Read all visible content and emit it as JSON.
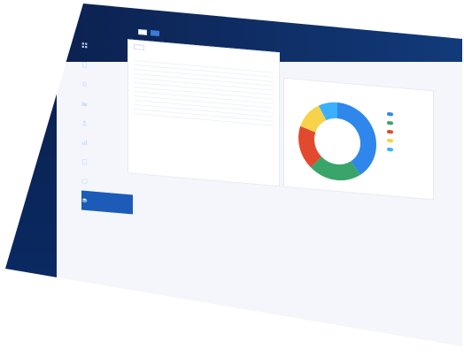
{
  "app": {
    "logo_text": "",
    "title": ""
  },
  "topbar": {
    "actions": [
      {
        "label": ""
      },
      {
        "label": ""
      },
      {
        "label": ""
      }
    ]
  },
  "tabs": [
    {
      "label": "",
      "active": false
    },
    {
      "label": "",
      "active": true
    }
  ],
  "sidebar": {
    "items": [
      {
        "label": "",
        "icon": "grid-icon"
      },
      {
        "label": "",
        "icon": "document-icon"
      },
      {
        "label": "",
        "icon": "settings-icon"
      },
      {
        "label": "",
        "icon": "folder-icon"
      },
      {
        "label": "",
        "icon": "user-icon"
      },
      {
        "label": "",
        "icon": "chart-icon"
      },
      {
        "label": "",
        "icon": "book-icon"
      },
      {
        "label": "",
        "icon": "cube-icon"
      },
      {
        "label": "",
        "icon": "layers-icon",
        "active": true
      },
      {
        "label": "",
        "icon": "list-icon",
        "sub": true
      },
      {
        "label": "",
        "icon": "list-icon",
        "sub": true
      },
      {
        "label": "",
        "icon": "list-icon",
        "sub": true
      },
      {
        "label": "",
        "icon": "list-icon",
        "sub": true
      },
      {
        "label": "",
        "icon": "shield-icon"
      }
    ]
  },
  "filters": {
    "select": ""
  },
  "stats": [
    {
      "label": ""
    },
    {
      "label": ""
    },
    {
      "label": ""
    }
  ],
  "table": {
    "columns": [
      "",
      "",
      "",
      "",
      "",
      "",
      "",
      ""
    ],
    "rows": [
      [
        "",
        "",
        "",
        "",
        "",
        "",
        "",
        ""
      ],
      [
        "",
        "",
        "",
        "",
        "",
        "",
        "",
        ""
      ],
      [
        "",
        "",
        "",
        "",
        "",
        "",
        "",
        ""
      ],
      [
        "",
        "",
        "",
        "",
        "",
        "",
        "",
        ""
      ],
      [
        "",
        "",
        "",
        "",
        "",
        "",
        "",
        ""
      ],
      [
        "",
        "",
        "",
        "",
        "",
        "",
        "",
        ""
      ],
      [
        "",
        "",
        "",
        "",
        "",
        "",
        "",
        ""
      ],
      [
        "",
        "",
        "",
        "",
        "",
        "",
        "",
        ""
      ],
      [
        "",
        "",
        "",
        "",
        "",
        "",
        "",
        ""
      ],
      [
        "",
        "",
        "",
        "",
        "",
        "",
        "",
        ""
      ],
      [
        "",
        "",
        "",
        "",
        "",
        "",
        "",
        ""
      ],
      [
        "",
        "",
        "",
        "",
        "",
        "",
        "",
        ""
      ]
    ]
  },
  "chart_panel": {
    "title": ""
  },
  "chart_data": {
    "type": "pie",
    "donut": true,
    "categories": [
      "",
      "",
      "",
      "",
      ""
    ],
    "values": [
      40,
      22,
      18,
      12,
      8
    ],
    "colors": [
      "#2f86eb",
      "#3aa56b",
      "#e14a2f",
      "#f6d34a",
      "#3bb0ff"
    ]
  }
}
